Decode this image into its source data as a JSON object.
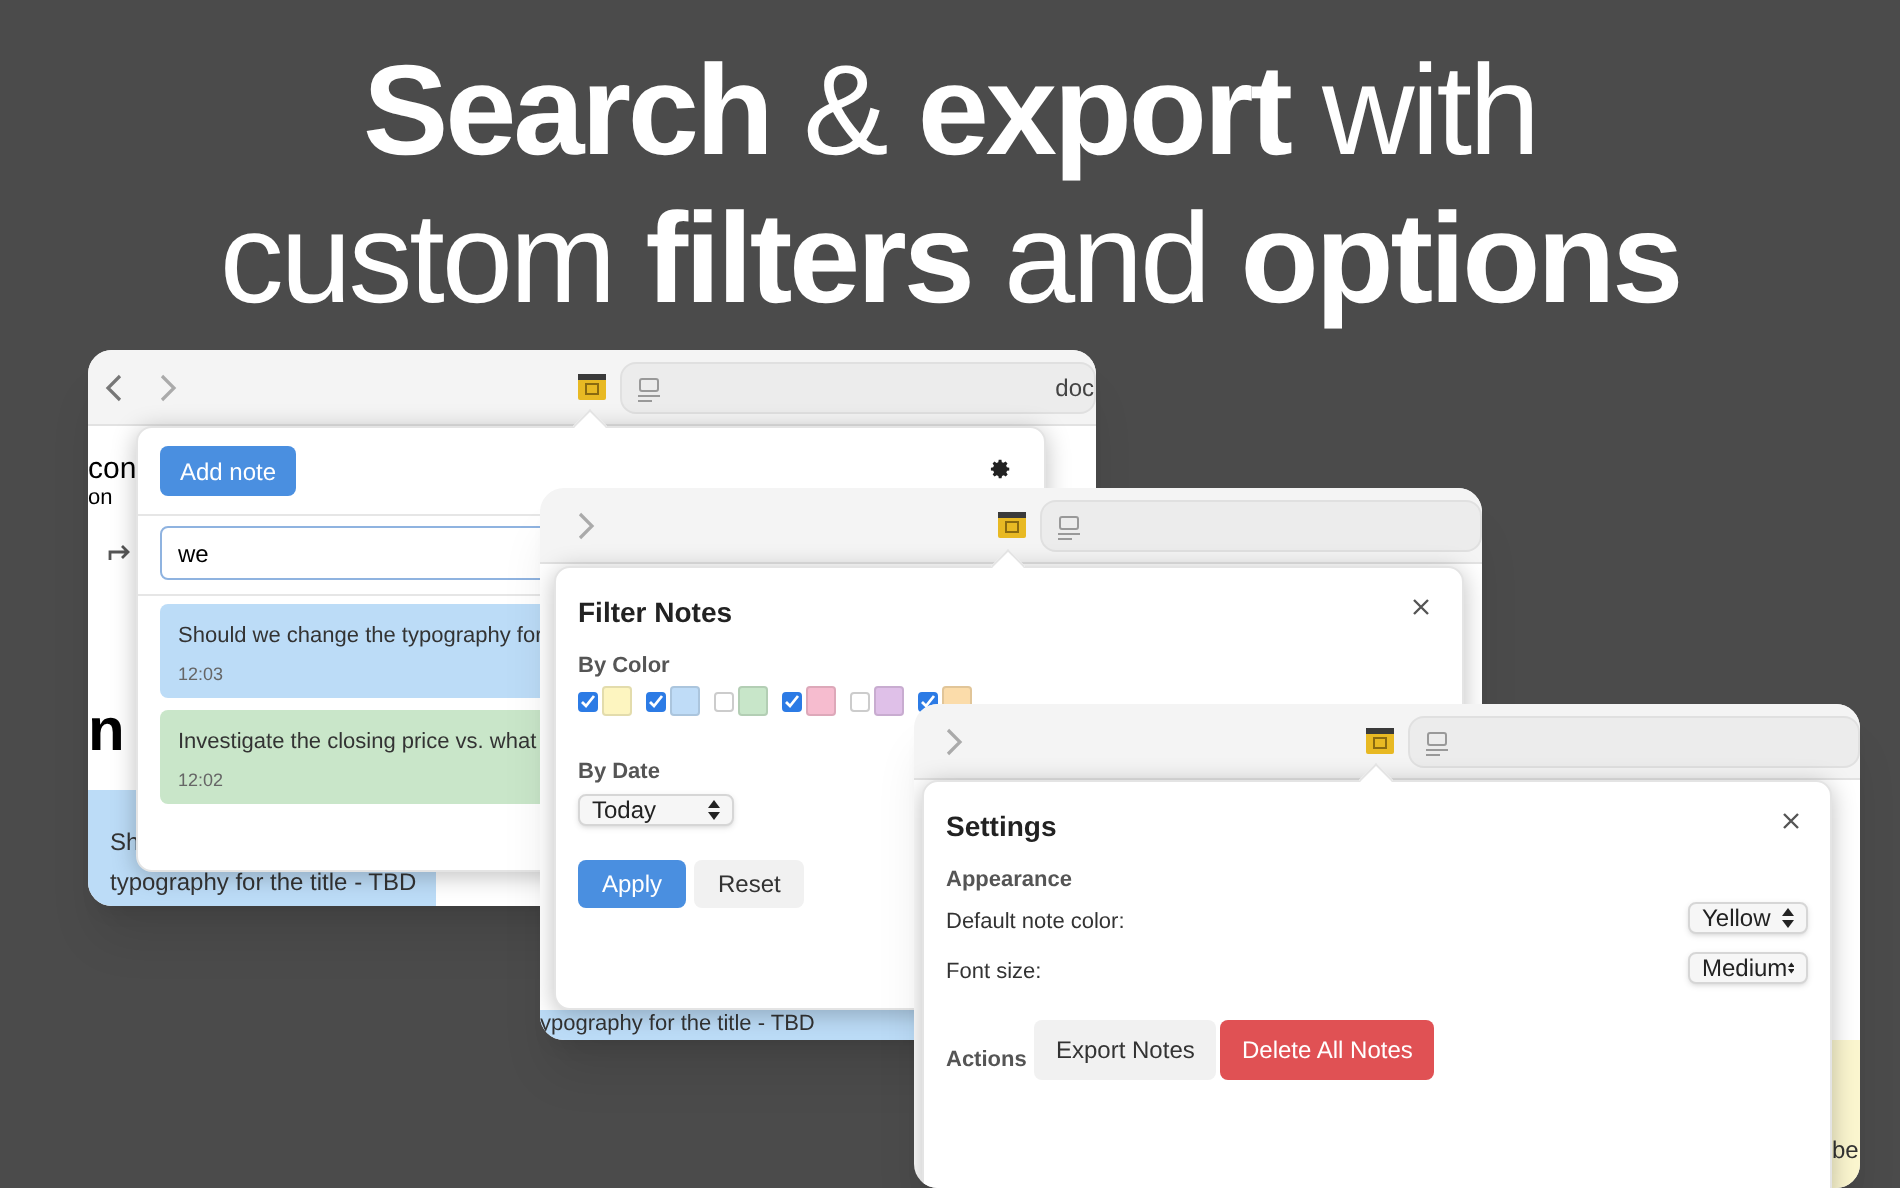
{
  "headline": {
    "line_1": "**Search** & **export** with",
    "line_2": "custom **filters** and **options**"
  },
  "notes_window": {
    "address_fragment": "doc",
    "page_fragments": [
      "con",
      "on",
      "n"
    ],
    "note_preview": [
      "Sh",
      "typography for the title - TBD"
    ],
    "popup": {
      "add_button": "Add note",
      "search": {
        "value": "we"
      },
      "notes": [
        {
          "text": "Should we change the typography for",
          "time": "12:03",
          "color": "#bcdcf7"
        },
        {
          "text": "Investigate the closing price vs. what",
          "time": "12:02",
          "color": "#c9e6c9"
        }
      ]
    }
  },
  "filter_window": {
    "note_preview": [
      "ypography for the title - TBD"
    ],
    "popup": {
      "title": "Filter Notes",
      "by_color_label": "By Color",
      "colors": [
        {
          "color": "#fdf5c0",
          "checked": true
        },
        {
          "color": "#bfdcf7",
          "checked": true
        },
        {
          "color": "#c8e6c9",
          "checked": false
        },
        {
          "color": "#f6bccf",
          "checked": true
        },
        {
          "color": "#dfc0e8",
          "checked": false
        },
        {
          "color": "#fbdcaa",
          "checked": true
        }
      ],
      "by_date_label": "By Date",
      "date_select": "Today",
      "buttons": [
        {
          "label": "Apply",
          "kind": "primary"
        },
        {
          "label": "Reset",
          "kind": "secondary"
        }
      ]
    }
  },
  "settings_window": {
    "page_fragment": "be",
    "popup": {
      "title": "Settings",
      "section": "Appearance",
      "rows": [
        {
          "label": "Default note color:",
          "value": "Yellow"
        },
        {
          "label": "Font size:",
          "value": "Medium"
        }
      ],
      "actions_label": "Actions",
      "buttons": [
        {
          "label": "Export Notes",
          "kind": "secondary"
        },
        {
          "label": "Delete All Notes",
          "kind": "danger"
        }
      ]
    }
  }
}
